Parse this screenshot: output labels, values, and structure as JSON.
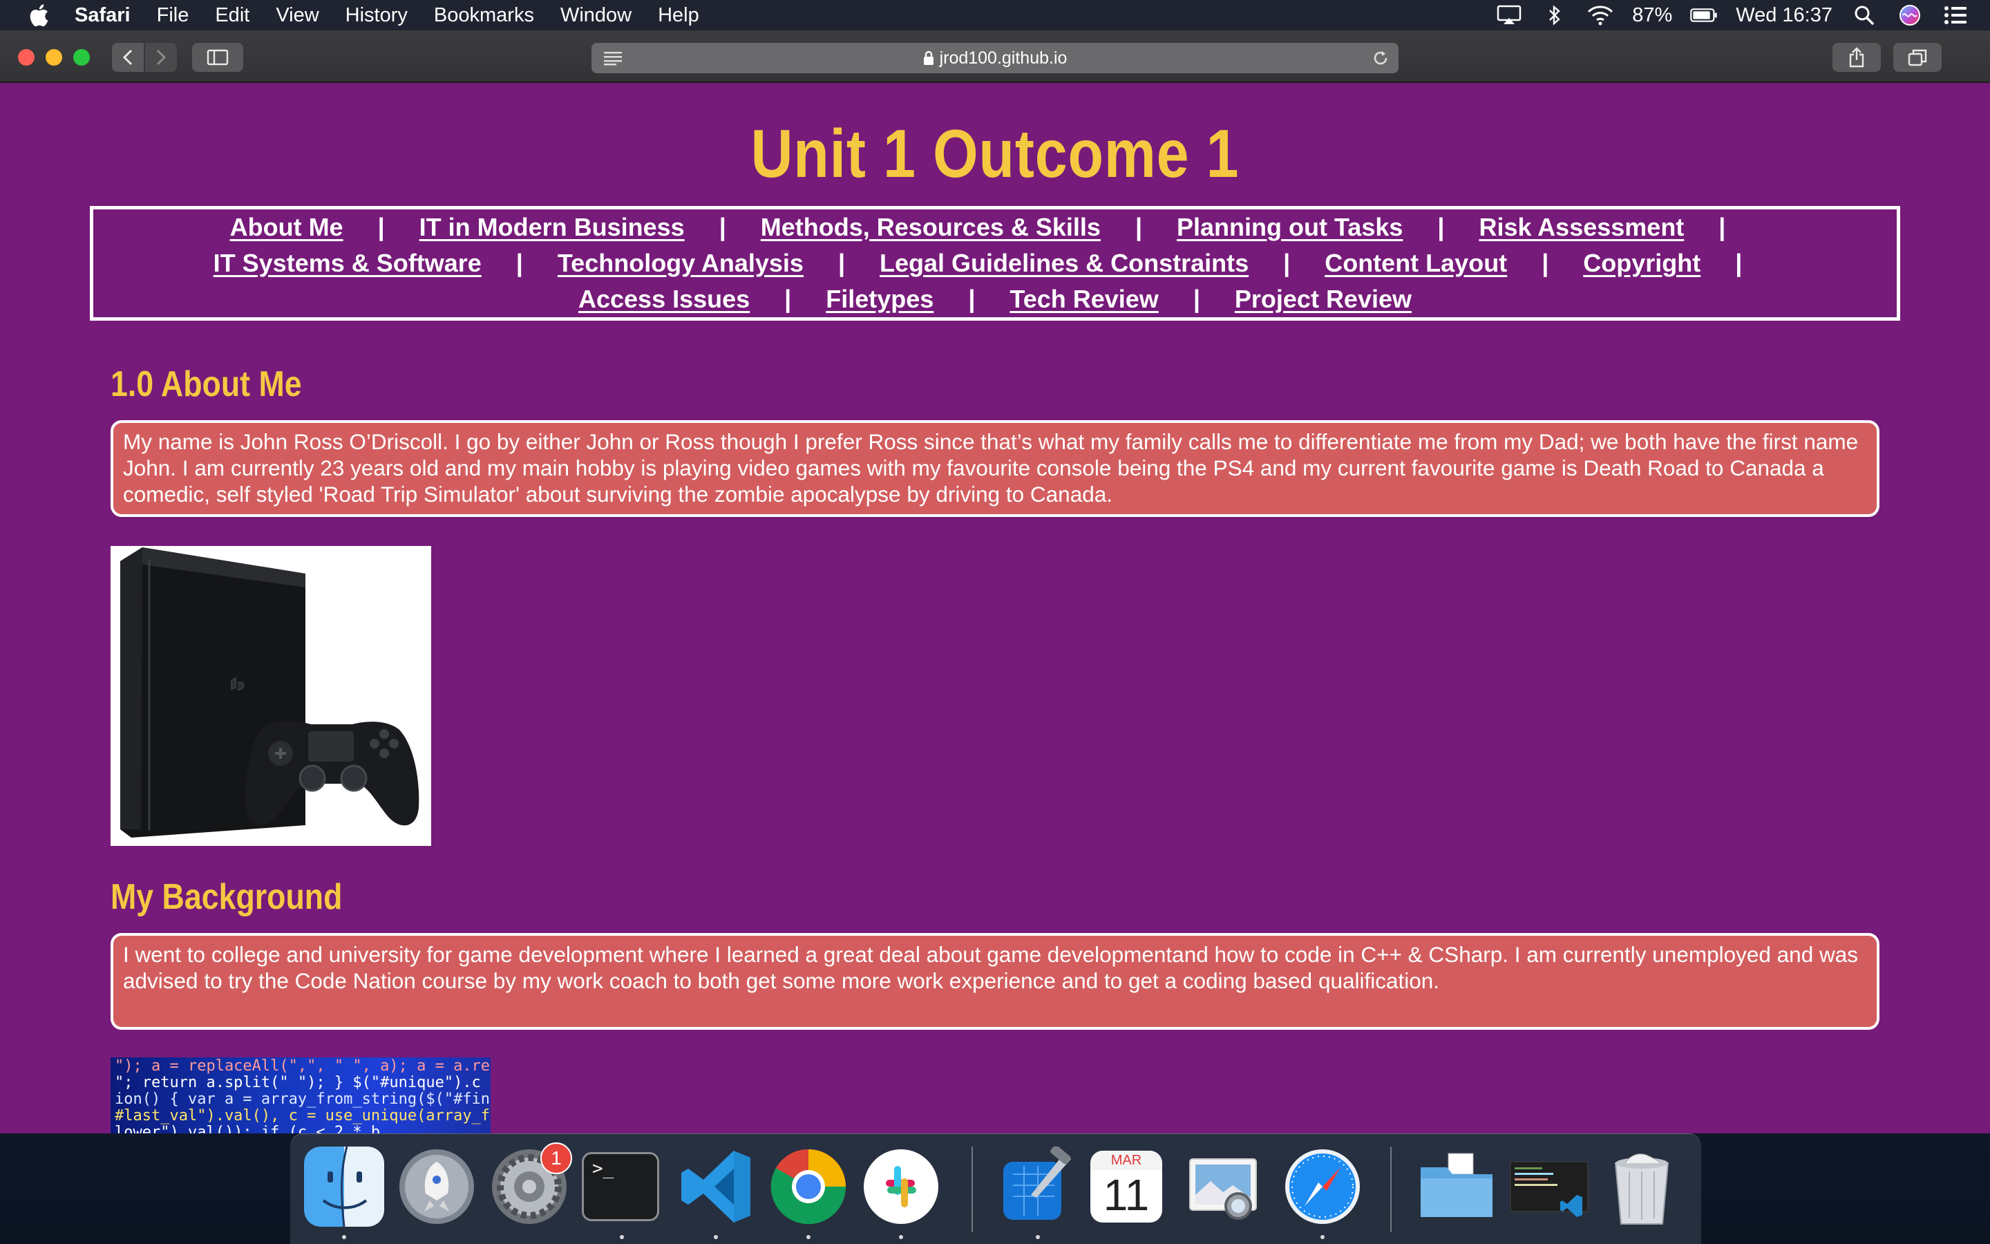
{
  "menubar": {
    "app_name": "Safari",
    "menus": [
      "File",
      "Edit",
      "View",
      "History",
      "Bookmarks",
      "Window",
      "Help"
    ],
    "battery_percent": "87%",
    "clock": "Wed 16:37"
  },
  "browser": {
    "url": "jrod100.github.io"
  },
  "page": {
    "title": "Unit 1 Outcome 1",
    "separator": "|",
    "nav": [
      "About Me",
      "IT in Modern Business",
      "Methods, Resources & Skills",
      "Planning out Tasks",
      "Risk Assessment",
      "IT Systems & Software",
      "Technology Analysis",
      "Legal Guidelines & Constraints",
      "Content Layout",
      "Copyright",
      "Access Issues",
      "Filetypes",
      "Tech Review",
      "Project Review"
    ],
    "about_heading": "1.0 About Me",
    "about_text": "My name is John Ross O’Driscoll. I go by either John or Ross though I prefer Ross since that’s what my family calls me to differentiate me from my Dad; we both have the first name John. I am currently 23 years old and my main hobby is playing video games with my favourite console being the PS4 and my current favourite game is Death Road to Canada a comedic, self styled 'Road Trip Simulator' about surviving the zombie apocalypse by driving to Canada.",
    "background_heading": "My Background",
    "background_text": "I went to college and university for game development where I learned a great deal about game developmentand how to code in C++ & CSharp. I am currently unemployed and was advised to try the Code Nation course by my work coach to both get some more work experience and to get a coding based qualification.",
    "code_image_lines": [
      "\"); a = replaceAll(\",\", \" \", a); a = a.repl",
      "\"; return a.split(\" \"); } $(\"#unique\").c",
      "ion() { var a = array_from_string($(\"#fin\").va",
      "#last_val\").val(), c = use_unique(array_from_",
      "lower\").val()); if (c < 2 * b"
    ]
  },
  "dock": {
    "apps": [
      "Finder",
      "Launchpad",
      "System Preferences",
      "Terminal",
      "Visual Studio Code",
      "Google Chrome",
      "Slack",
      "Xcode",
      "Calendar",
      "Preview",
      "Safari",
      "Downloads",
      "VS Code Window",
      "Trash"
    ],
    "system_prefs_badge": "1",
    "calendar_month": "MAR",
    "calendar_day": "11",
    "terminal_prompt": ">_"
  }
}
